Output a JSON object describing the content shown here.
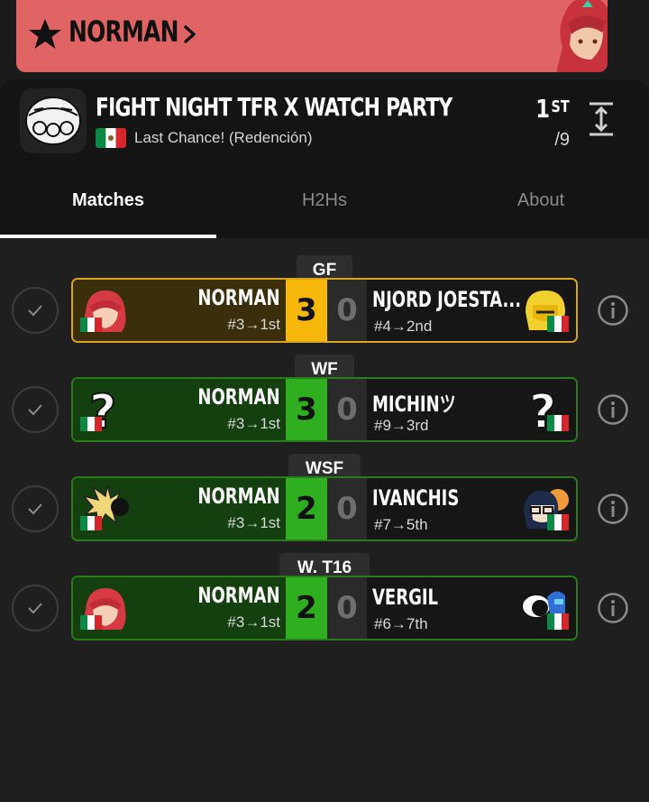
{
  "banner": {
    "player_name": "NORMAN",
    "accent": "#e06464"
  },
  "tournament": {
    "title": "FIGHT NIGHT TFR X WATCH PARTY",
    "event": "Last Chance! (Redención)",
    "placement": "1",
    "placement_suffix": "ST",
    "entrants": "/9"
  },
  "tabs": [
    {
      "label": "Matches",
      "active": true
    },
    {
      "label": "H2Hs",
      "active": false
    },
    {
      "label": "About",
      "active": false
    }
  ],
  "matches": [
    {
      "round": "GF",
      "winner": "NORMAN",
      "winner_seed": "#3→1st",
      "winner_score": "3",
      "loser": "NJORD JOESTA...",
      "loser_seed": "#4→2nd",
      "loser_score": "0",
      "highlight": "#f7b80b"
    },
    {
      "round": "WF",
      "winner": "NORMAN",
      "winner_seed": "#3→1st",
      "winner_score": "3",
      "loser": "MICHINツ",
      "loser_seed": "#9→3rd",
      "loser_score": "0",
      "highlight": "#2fae20"
    },
    {
      "round": "WSF",
      "winner": "NORMAN",
      "winner_seed": "#3→1st",
      "winner_score": "2",
      "loser": "IVANCHIS",
      "loser_seed": "#7→5th",
      "loser_score": "0",
      "highlight": "#2fae20"
    },
    {
      "round": "W. T16",
      "winner": "NORMAN",
      "winner_seed": "#3→1st",
      "winner_score": "2",
      "loser": "VERGIL",
      "loser_seed": "#6→7th",
      "loser_score": "0",
      "highlight": "#2fae20"
    }
  ]
}
